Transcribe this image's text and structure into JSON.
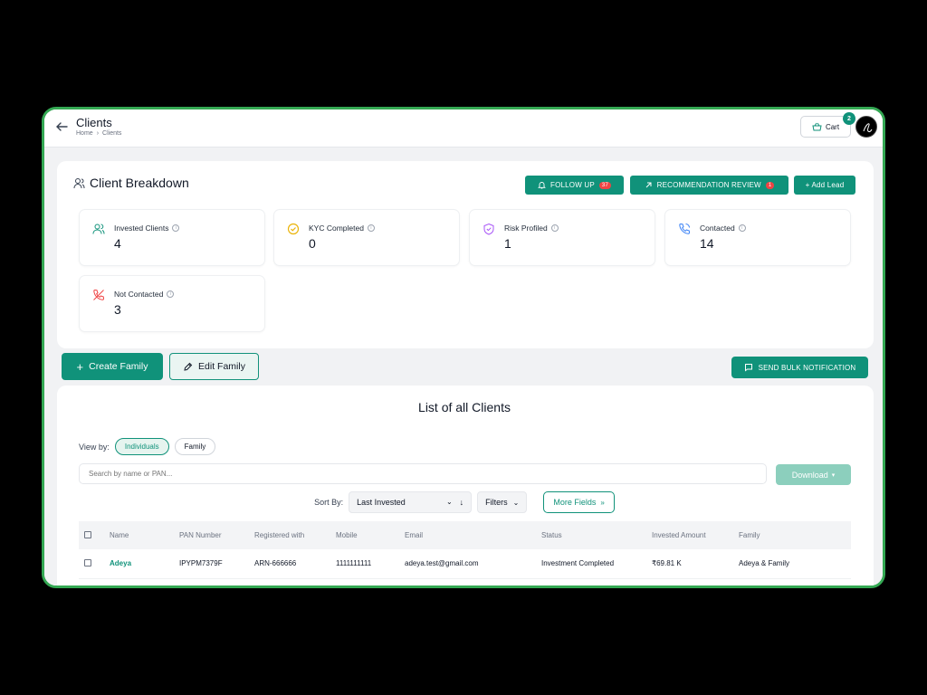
{
  "header": {
    "title": "Clients",
    "breadcrumb": [
      "Home",
      "Clients"
    ],
    "cart_label": "Cart",
    "cart_count": "2"
  },
  "breakdown": {
    "title": "Client Breakdown",
    "follow_up_label": "FOLLOW UP",
    "follow_up_count": "37",
    "recommendation_label": "RECOMMENDATION REVIEW",
    "recommendation_count": "1",
    "add_lead_label": "+ Add Lead",
    "stats": [
      {
        "label": "Invested Clients",
        "value": "4",
        "icon": "users-icon",
        "color": "#10927a"
      },
      {
        "label": "KYC Completed",
        "value": "0",
        "icon": "check-badge-icon",
        "color": "#eab308"
      },
      {
        "label": "Risk Profiled",
        "value": "1",
        "icon": "shield-icon",
        "color": "#a855f7"
      },
      {
        "label": "Contacted",
        "value": "14",
        "icon": "phone-icon",
        "color": "#3b82f6"
      },
      {
        "label": "Not Contacted",
        "value": "3",
        "icon": "phone-off-icon",
        "color": "#ef4444"
      }
    ]
  },
  "actions": {
    "create_family": "Create Family",
    "edit_family": "Edit Family",
    "bulk_notification": "SEND BULK NOTIFICATION"
  },
  "list": {
    "title": "List of all Clients",
    "view_by_label": "View by:",
    "view_options": [
      "Individuals",
      "Family"
    ],
    "search_placeholder": "Search by name or PAN...",
    "download_label": "Download",
    "sort_by_label": "Sort By:",
    "sort_value": "Last Invested",
    "filters_label": "Filters",
    "more_fields_label": "More Fields",
    "columns": [
      "Name",
      "PAN Number",
      "Registered with",
      "Mobile",
      "Email",
      "Status",
      "Invested Amount",
      "Family"
    ],
    "rows": [
      {
        "name": "Adeya",
        "pan": "IPYPM7379F",
        "registered": "ARN-666666",
        "mobile": "1111111111",
        "email": "adeya.test@gmail.com",
        "status": "Investment Completed",
        "amount": "₹69.81 K",
        "family": "Adeya & Family"
      }
    ]
  },
  "colors": {
    "accent": "#10927a",
    "frame": "#34a853",
    "badge": "#ef4444"
  }
}
